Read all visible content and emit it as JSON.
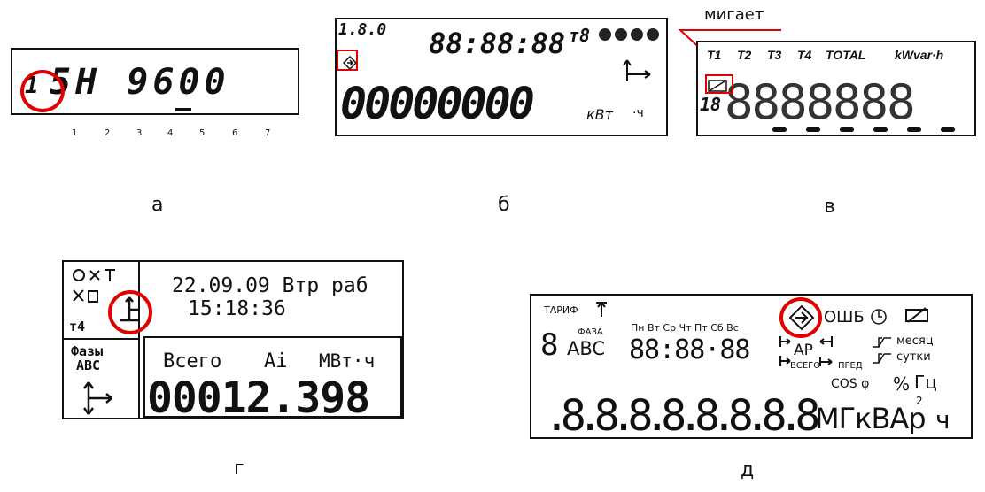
{
  "captions": {
    "a": "а",
    "b": "б",
    "v": "в",
    "g": "г",
    "d": "д"
  },
  "annotation": {
    "blinks": "мигает"
  },
  "panel_a": {
    "first": "1",
    "display": "5H  9600",
    "positions": [
      "1",
      "2",
      "3",
      "4",
      "5",
      "6",
      "7"
    ]
  },
  "panel_b": {
    "obis": "1.8.0",
    "time": "88:88:88",
    "tariff": "т8",
    "main": "00000000",
    "unit_power": "кВт",
    "unit_hour": "·ч"
  },
  "panel_v": {
    "headers": [
      "T1",
      "T2",
      "T3",
      "T4",
      "TOTAL",
      "kWvar·h"
    ],
    "left": "18",
    "digits": "8888888"
  },
  "panel_g": {
    "datetime": "22.09.09 Втр раб",
    "time": "15:18:36",
    "corner": "т4",
    "phases_label": "Фазы",
    "phases": "ABC",
    "total_label": "Всего",
    "energy_type": "Ai",
    "unit": "МВт·ч",
    "value": "00012.398"
  },
  "panel_d": {
    "tariff": "ТАРИФ",
    "phase_label": "ФАЗА",
    "phases": "ABC",
    "eight": "8",
    "days": "Пн Вт Ср Чт Пт Сб Вс",
    "time": "88:88·88",
    "ap": "АР",
    "vsego": "ВСЕГО",
    "pred": "ПРЕД",
    "err": "ОШБ",
    "month": "месяц",
    "day": "сутки",
    "cos": "COS φ",
    "percent": "%",
    "hz": "Гц",
    "main": ".8.8.8.8.8.8.8.8",
    "unit": "МГкВАр",
    "superscript": "2",
    "hour": "ч"
  }
}
